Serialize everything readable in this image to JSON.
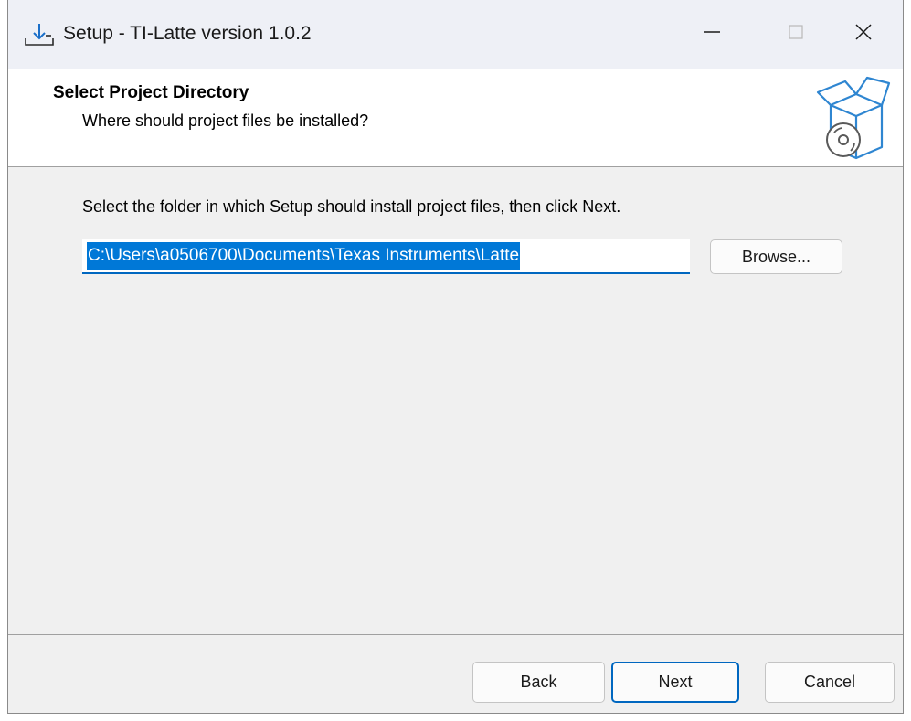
{
  "window": {
    "title": "Setup - TI-Latte version 1.0.2",
    "icon": "setup-download-icon"
  },
  "caption_buttons": {
    "minimize": "minimize-icon",
    "maximize": "maximize-icon",
    "close": "close-icon"
  },
  "header": {
    "title": "Select Project Directory",
    "subtitle": "Where should project files be installed?",
    "image": "install-box-disc-icon"
  },
  "body": {
    "instruction": "Select the folder in which Setup should install project files, then click Next.",
    "path_value": "C:\\Users\\a0506700\\Documents\\Texas Instruments\\Latte",
    "browse_label": "Browse..."
  },
  "footer": {
    "back_label": "Back",
    "next_label": "Next",
    "cancel_label": "Cancel"
  },
  "colors": {
    "accent": "#0067c0",
    "selection": "#0078d7",
    "titlebar": "#eef0f6",
    "dialog_bg": "#f0f0f0"
  }
}
